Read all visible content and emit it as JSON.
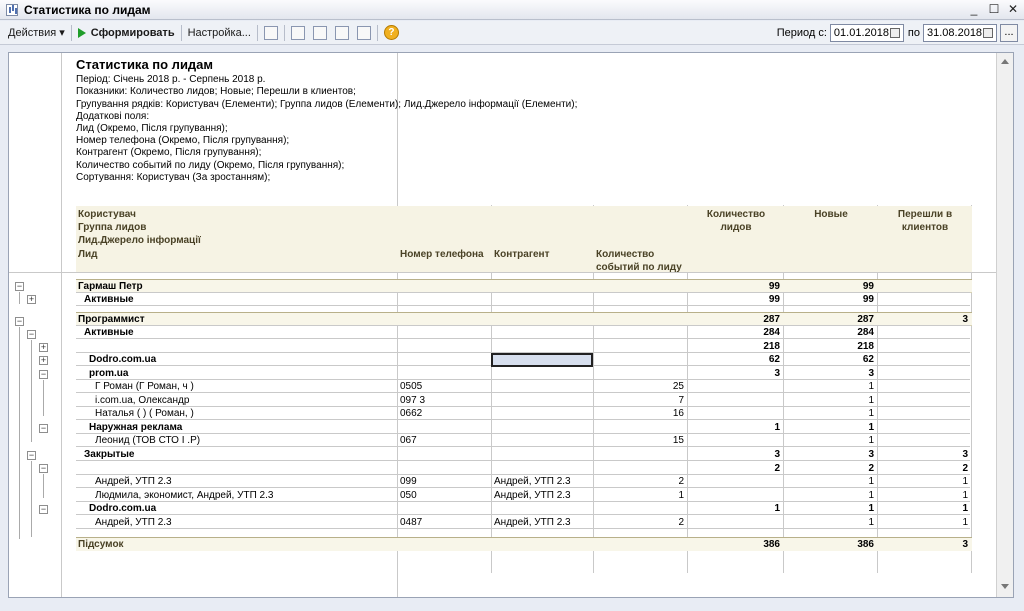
{
  "window": {
    "title": "Статистика по лидам"
  },
  "toolbar": {
    "actions": "Действия ▾",
    "generate": "Сформировать",
    "settings": "Настройка...",
    "period_from_label": "Период с:",
    "date_from": "01.01.2018",
    "period_to_label": "по",
    "date_to": "31.08.2018",
    "dots": "..."
  },
  "report": {
    "title": "Статистика по лидам",
    "info": [
      "Період: Січень 2018 р. - Серпень 2018 р.",
      "Показники: Количество лидов; Новые; Перешли в клиентов;",
      "Групування рядків: Користувач (Елементи); Группа лидов (Елементи); Лид.Джерело інформації (Елементи);",
      "Додаткові поля:",
      "Лид (Окремо, Після групування);",
      "Номер телефона (Окремо, Після групування);",
      "Контрагент (Окремо, Після групування);",
      "Количество событий по лиду (Окремо, Після групування);",
      "Сортування: Користувач (За зростанням);"
    ],
    "headers": {
      "user": "Користувач",
      "group": "Группа лидов",
      "source": "Лид.Джерело інформації",
      "lead": "Лид",
      "phone": "Номер телефона",
      "counterparty": "Контрагент",
      "events": "Количество событий по лиду",
      "leads_count": "Количество лидов",
      "new": "Новые",
      "converted": "Перешли в клиентов"
    },
    "rows": [
      {
        "label": "Гармаш Петр",
        "phone": "",
        "cp": "",
        "ev": "",
        "c1": "99",
        "c2": "99",
        "c3": ""
      },
      {
        "label": "Активные",
        "phone": "",
        "cp": "",
        "ev": "",
        "c1": "99",
        "c2": "99",
        "c3": ""
      },
      {
        "label": "Программист",
        "phone": "",
        "cp": "",
        "ev": "",
        "c1": "287",
        "c2": "287",
        "c3": "3"
      },
      {
        "label": "Активные",
        "phone": "",
        "cp": "",
        "ev": "",
        "c1": "284",
        "c2": "284",
        "c3": ""
      },
      {
        "label": "",
        "phone": "",
        "cp": "",
        "ev": "",
        "c1": "218",
        "c2": "218",
        "c3": ""
      },
      {
        "label": "Dodro.com.ua",
        "phone": "",
        "cp": "",
        "ev": "",
        "c1": "62",
        "c2": "62",
        "c3": ""
      },
      {
        "label": "prom.ua",
        "phone": "",
        "cp": "",
        "ev": "",
        "c1": "3",
        "c2": "3",
        "c3": ""
      },
      {
        "label": "Г        Роман (Г        Роман, ч            )",
        "phone": "0505",
        "cp": "",
        "ev": "25",
        "c1": "",
        "c2": "1",
        "c3": ""
      },
      {
        "label": "         i.com.ua, Олександр",
        "phone": "097          3",
        "cp": "",
        "ev": "7",
        "c1": "",
        "c2": "1",
        "c3": ""
      },
      {
        "label": "Наталья (          ) (         Роман,         )",
        "phone": "0662",
        "cp": "",
        "ev": "16",
        "c1": "",
        "c2": "1",
        "c3": ""
      },
      {
        "label": "Наружная реклама",
        "phone": "",
        "cp": "",
        "ev": "",
        "c1": "1",
        "c2": "1",
        "c3": ""
      },
      {
        "label": "       Леонид (ТОВ СТО I         .Р)",
        "phone": "067",
        "cp": "",
        "ev": "15",
        "c1": "",
        "c2": "1",
        "c3": ""
      },
      {
        "label": "Закрытые",
        "phone": "",
        "cp": "",
        "ev": "",
        "c1": "3",
        "c2": "3",
        "c3": "3"
      },
      {
        "label": "",
        "phone": "",
        "cp": "",
        "ev": "",
        "c1": "2",
        "c2": "2",
        "c3": "2"
      },
      {
        "label": "Андрей, УТП 2.3",
        "phone": "099",
        "cp": "Андрей, УТП 2.3",
        "ev": "2",
        "c1": "",
        "c2": "1",
        "c3": "1"
      },
      {
        "label": "Людмила, экономист, Андрей, УТП 2.3",
        "phone": "050",
        "cp": "Андрей, УТП 2.3",
        "ev": "1",
        "c1": "",
        "c2": "1",
        "c3": "1"
      },
      {
        "label": "Dodro.com.ua",
        "phone": "",
        "cp": "",
        "ev": "",
        "c1": "1",
        "c2": "1",
        "c3": "1"
      },
      {
        "label": "Андрей, УТП 2.3",
        "phone": "0487",
        "cp": "Андрей, УТП 2.3",
        "ev": "2",
        "c1": "",
        "c2": "1",
        "c3": "1"
      }
    ],
    "total": {
      "label": "Підсумок",
      "c1": "386",
      "c2": "386",
      "c3": "3"
    }
  }
}
